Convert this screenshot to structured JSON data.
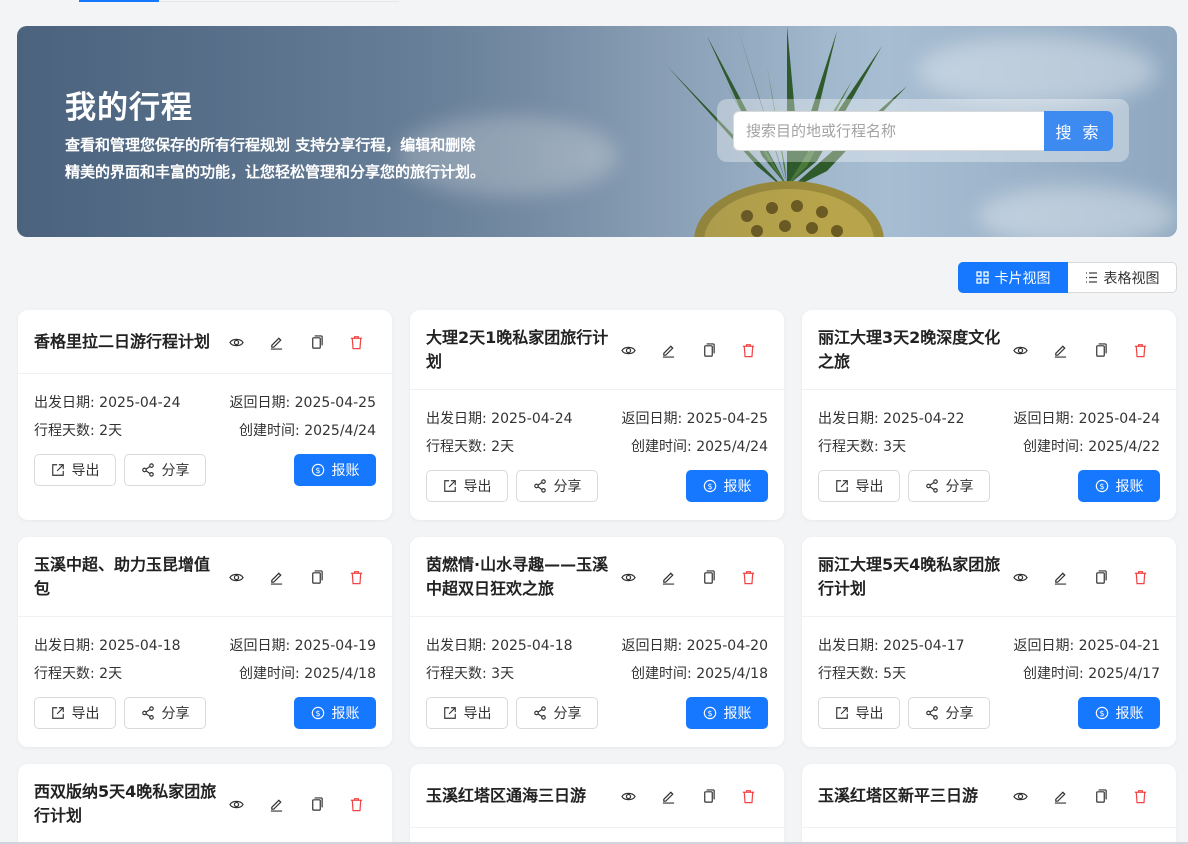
{
  "banner": {
    "title": "我的行程",
    "subtitle_line1": "查看和管理您保存的所有行程规划 支持分享行程，编辑和删除",
    "subtitle_line2": "精美的界面和丰富的功能，让您轻松管理和分享您的旅行计划。",
    "search_placeholder": "搜索目的地或行程名称",
    "search_button": "搜 索"
  },
  "view_toggle": {
    "card_view": "卡片视图",
    "table_view": "表格视图",
    "active": "card_view"
  },
  "labels": {
    "depart": "出发日期: ",
    "return": "返回日期: ",
    "days": "行程天数: ",
    "created": "创建时间: ",
    "export": "导出",
    "share": "分享",
    "pay": "报账"
  },
  "colors": {
    "primary": "#1677ff",
    "delete": "#ef4444",
    "page_bg": "#f3f4f6"
  },
  "trips": [
    {
      "title": "香格里拉二日游行程计划",
      "depart": "2025-04-24",
      "return": "2025-04-25",
      "days": "2天",
      "created": "2025/4/24"
    },
    {
      "title": "大理2天1晚私家团旅行计划",
      "depart": "2025-04-24",
      "return": "2025-04-25",
      "days": "2天",
      "created": "2025/4/24"
    },
    {
      "title": "丽江大理3天2晚深度文化之旅",
      "depart": "2025-04-22",
      "return": "2025-04-24",
      "days": "3天",
      "created": "2025/4/22"
    },
    {
      "title": "玉溪中超、助力玉昆增值包",
      "depart": "2025-04-18",
      "return": "2025-04-19",
      "days": "2天",
      "created": "2025/4/18"
    },
    {
      "title": "茵燃情·山水寻趣——玉溪中超双日狂欢之旅",
      "depart": "2025-04-18",
      "return": "2025-04-20",
      "days": "3天",
      "created": "2025/4/18"
    },
    {
      "title": "丽江大理5天4晚私家团旅行计划",
      "depart": "2025-04-17",
      "return": "2025-04-21",
      "days": "5天",
      "created": "2025/4/17"
    },
    {
      "title": "西双版纳5天4晚私家团旅行计划"
    },
    {
      "title": "玉溪红塔区通海三日游"
    },
    {
      "title": "玉溪红塔区新平三日游"
    }
  ]
}
